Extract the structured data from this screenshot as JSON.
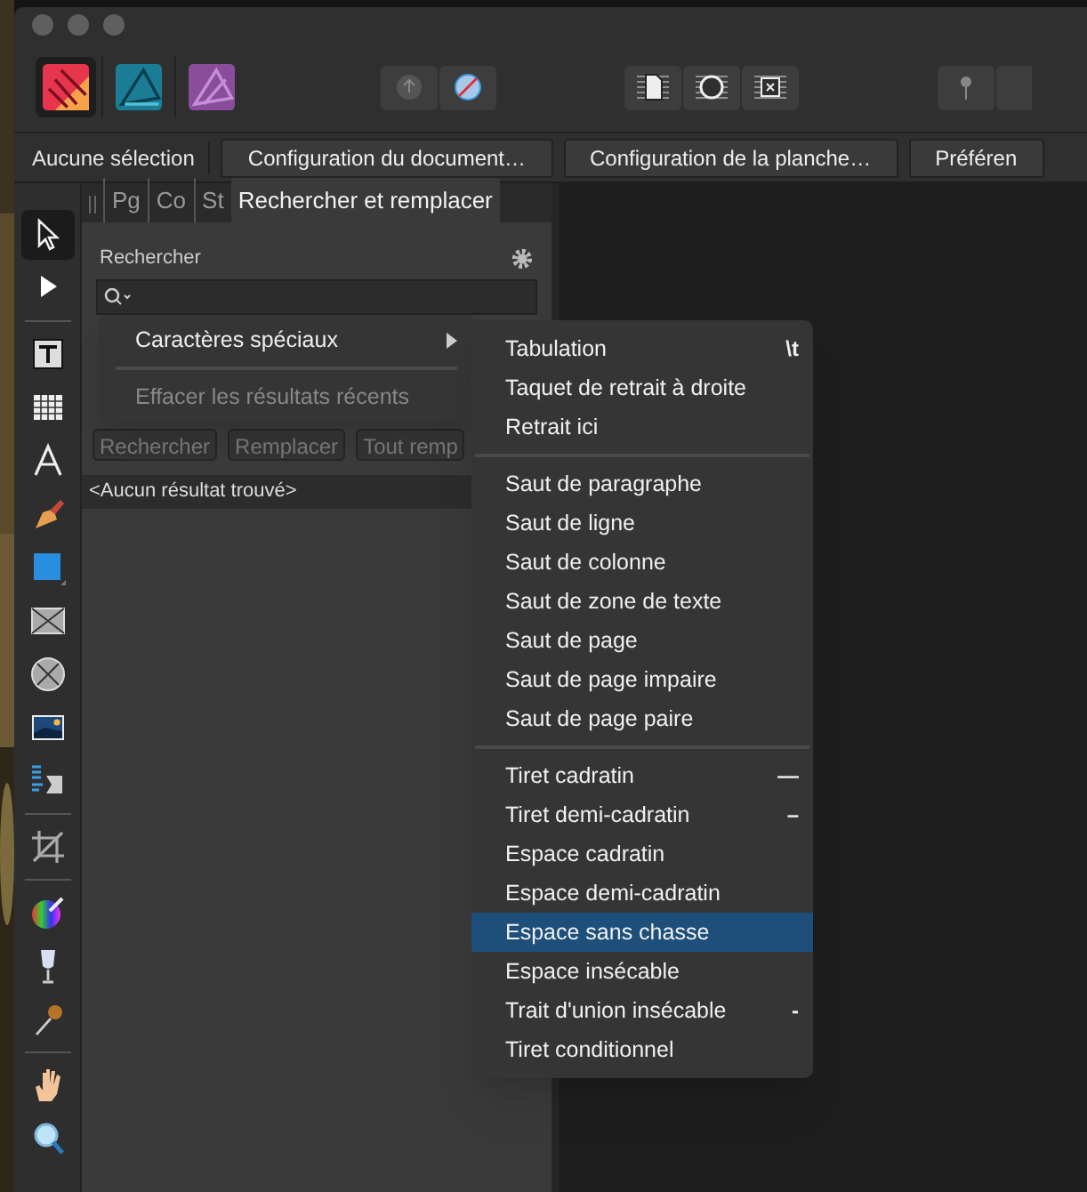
{
  "apps": [
    {
      "selected": true
    },
    {
      "selected": false
    },
    {
      "selected": false
    }
  ],
  "context_bar": {
    "selection": "Aucune sélection",
    "buttons": [
      "Configuration du document…",
      "Configuration de la planche…",
      "Préféren"
    ]
  },
  "tools": [
    {
      "kind": "tool",
      "selected": true
    },
    {
      "kind": "tool",
      "selected": false
    },
    {
      "kind": "separator"
    },
    {
      "kind": "tool",
      "selected": false
    },
    {
      "kind": "tool",
      "selected": false
    },
    {
      "kind": "tool",
      "selected": false
    },
    {
      "kind": "tool",
      "selected": false
    },
    {
      "kind": "tool",
      "selected": false
    },
    {
      "kind": "tool",
      "selected": false
    },
    {
      "kind": "tool",
      "selected": false
    },
    {
      "kind": "tool",
      "selected": false
    },
    {
      "kind": "tool",
      "selected": false
    },
    {
      "kind": "separator"
    },
    {
      "kind": "tool",
      "selected": false
    },
    {
      "kind": "separator"
    },
    {
      "kind": "tool",
      "selected": false
    },
    {
      "kind": "tool",
      "selected": false
    },
    {
      "kind": "tool",
      "selected": false
    },
    {
      "kind": "separator"
    },
    {
      "kind": "tool",
      "selected": false
    },
    {
      "kind": "tool",
      "selected": false
    }
  ],
  "panel": {
    "tabs": [
      {
        "label": "Pg",
        "selected": false
      },
      {
        "label": "Co",
        "selected": false
      },
      {
        "label": "St",
        "selected": false
      },
      {
        "label": "Rechercher et remplacer",
        "selected": true
      }
    ],
    "search_label": "Rechercher",
    "buttons": [
      "Rechercher",
      "Remplacer",
      "Tout remp"
    ],
    "results": "<Aucun résultat trouvé>"
  },
  "search_menu": [
    {
      "kind": "submenu",
      "label": "Caractères spéciaux",
      "disabled": false
    },
    {
      "kind": "separator"
    },
    {
      "kind": "item",
      "label": "Effacer les résultats récents",
      "disabled": true
    }
  ],
  "special_characters": [
    {
      "kind": "item",
      "label": "Tabulation",
      "shortcut": "\\t",
      "selected": false
    },
    {
      "kind": "item",
      "label": "Taquet de retrait à droite",
      "selected": false
    },
    {
      "kind": "item",
      "label": "Retrait ici",
      "selected": false
    },
    {
      "kind": "separator"
    },
    {
      "kind": "item",
      "label": "Saut de paragraphe",
      "selected": false
    },
    {
      "kind": "item",
      "label": "Saut de ligne",
      "selected": false
    },
    {
      "kind": "item",
      "label": "Saut de colonne",
      "selected": false
    },
    {
      "kind": "item",
      "label": "Saut de zone de texte",
      "selected": false
    },
    {
      "kind": "item",
      "label": "Saut de page",
      "selected": false
    },
    {
      "kind": "item",
      "label": "Saut de page impaire",
      "selected": false
    },
    {
      "kind": "item",
      "label": "Saut de page paire",
      "selected": false
    },
    {
      "kind": "separator"
    },
    {
      "kind": "item",
      "label": "Tiret cadratin",
      "shortcut": "—",
      "selected": false
    },
    {
      "kind": "item",
      "label": "Tiret demi-cadratin",
      "shortcut": "–",
      "selected": false
    },
    {
      "kind": "item",
      "label": "Espace cadratin",
      "selected": false
    },
    {
      "kind": "item",
      "label": "Espace demi-cadratin",
      "selected": false
    },
    {
      "kind": "item",
      "label": "Espace sans chasse",
      "selected": true
    },
    {
      "kind": "item",
      "label": "Espace insécable",
      "selected": false
    },
    {
      "kind": "item",
      "label": "Trait d'union insécable",
      "shortcut": "-",
      "selected": false
    },
    {
      "kind": "item",
      "label": "Tiret conditionnel",
      "selected": false
    }
  ]
}
